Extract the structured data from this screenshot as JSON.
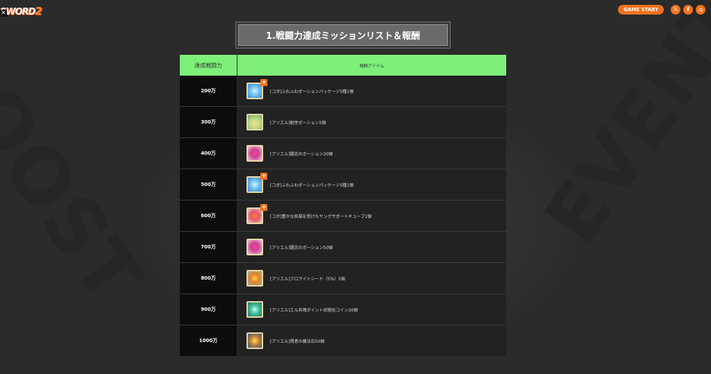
{
  "logo": {
    "text": "SWORD",
    "num": "2"
  },
  "close_label": "×",
  "header": {
    "game_start": "GAME START",
    "icons": [
      {
        "name": "x-icon",
        "glyph": "𝕏"
      },
      {
        "name": "facebook-icon",
        "glyph": "f"
      },
      {
        "name": "home-icon",
        "glyph": "⌂"
      }
    ]
  },
  "background_text": {
    "left": "BOOST",
    "right": "EVENT"
  },
  "title": "1.戦闘力達成ミッションリスト＆報酬",
  "table": {
    "col1_header": "達成戦闘力",
    "col2_header": "報酬アイテム",
    "rows": [
      {
        "power": "200万",
        "reward": "[コボ]ふわふわポーションパッケージ5種1個",
        "icon": "potion-package-icon",
        "color": "blue",
        "plus": "+"
      },
      {
        "power": "300万",
        "reward": "[アリエル]耐性ポーション5個",
        "icon": "resistance-potion-icon",
        "color": "green",
        "plus": ""
      },
      {
        "power": "400万",
        "reward": "[アリエル]闘志のポーション30個",
        "icon": "fighting-spirit-potion-icon",
        "color": "pink",
        "plus": ""
      },
      {
        "power": "500万",
        "reward": "[コボ]ふわふわポーションパッケージ5種1個",
        "icon": "potion-package-icon",
        "color": "blue",
        "plus": "+"
      },
      {
        "power": "600万",
        "reward": "[コボ]豊かな祝福を受けたヤングサポートキューブ1個",
        "icon": "support-cube-icon",
        "color": "peach",
        "plus": "+"
      },
      {
        "power": "700万",
        "reward": "[アリエル]闘志のポーション50個",
        "icon": "fighting-spirit-potion-icon",
        "color": "pink",
        "plus": ""
      },
      {
        "power": "800万",
        "reward": "[アリエル]クロライトシード（5%）5個",
        "icon": "chlorite-seed-icon",
        "color": "amber",
        "plus": ""
      },
      {
        "power": "900万",
        "reward": "[アリエル]エル共鳴ポイント初期化コイン30個",
        "icon": "el-resonance-coin-icon",
        "color": "teal",
        "plus": ""
      },
      {
        "power": "1000万",
        "reward": "[アリエル]賢者の魔法石50個",
        "icon": "sage-magic-stone-icon",
        "color": "gold",
        "plus": ""
      }
    ]
  }
}
